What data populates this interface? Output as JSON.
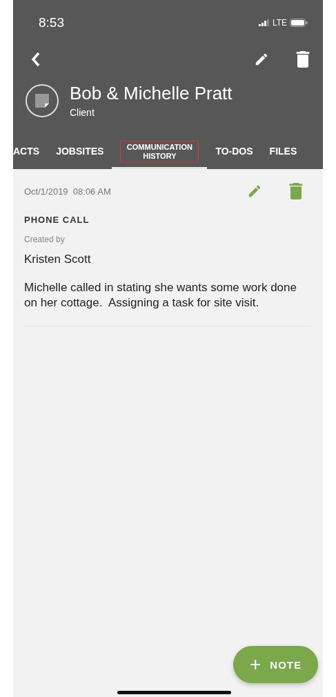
{
  "status_bar": {
    "time": "8:53",
    "network": "LTE"
  },
  "header": {
    "title": "Bob & Michelle Pratt",
    "subtitle": "Client"
  },
  "tabs": [
    {
      "label": "ACTS",
      "selected": false
    },
    {
      "label": "JOBSITES",
      "selected": false
    },
    {
      "label": "COMMUNICATION HISTORY",
      "selected": true
    },
    {
      "label": "TO-DOS",
      "selected": false
    },
    {
      "label": "FILES",
      "selected": false
    }
  ],
  "entries": [
    {
      "timestamp": "Oct/1/2019  08:06 AM",
      "type": "PHONE CALL",
      "created_label": "Created by",
      "author": "Kristen Scott",
      "message": "Michelle called in stating she wants some work done on her cottage.  Assigning a task for site visit."
    }
  ],
  "fab": {
    "icon": "+",
    "label": "NOTE"
  }
}
